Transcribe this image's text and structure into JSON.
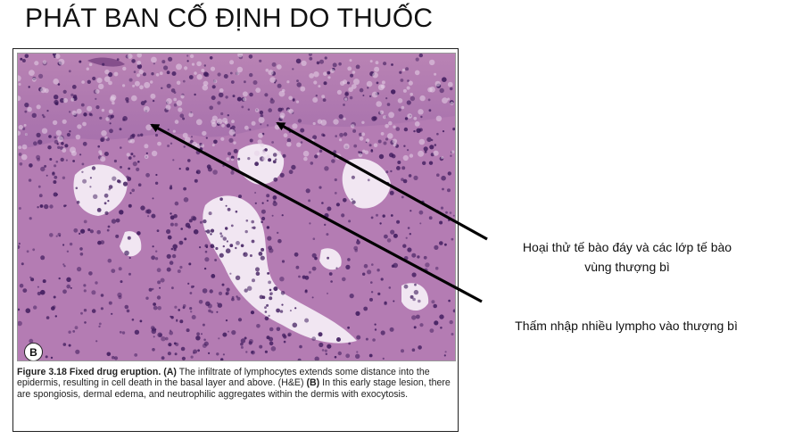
{
  "slide": {
    "title": "PHÁT BAN CỐ ĐỊNH DO THUỐC"
  },
  "figure": {
    "panel_label": "B",
    "caption": {
      "figure_no": "Figure 3.18",
      "figure_title": "Fixed drug eruption.",
      "part_a_label": "(A)",
      "part_a_text": " The infiltrate of lymphocytes extends some distance into the epidermis, resulting in cell death in the basal layer and above. (H&E) ",
      "part_b_label": "(B)",
      "part_b_text": " In this early stage lesion, there are spongiosis, dermal edema, and neutrophilic aggregates within the dermis with exocytosis."
    }
  },
  "annotations": {
    "basal_necrosis_line1": "Hoại thử tế bào đáy và các lớp tế bào",
    "basal_necrosis_line2": "vùng thượng bì",
    "lymphocyte_infiltration": "Thấm nhập nhiều lympho vào thượng bì"
  },
  "colors": {
    "stain_pink": "#c48bbd",
    "stain_purple": "#7a3f88",
    "nuclei": "#3d1a5c",
    "edema": "#f1e6f2"
  }
}
